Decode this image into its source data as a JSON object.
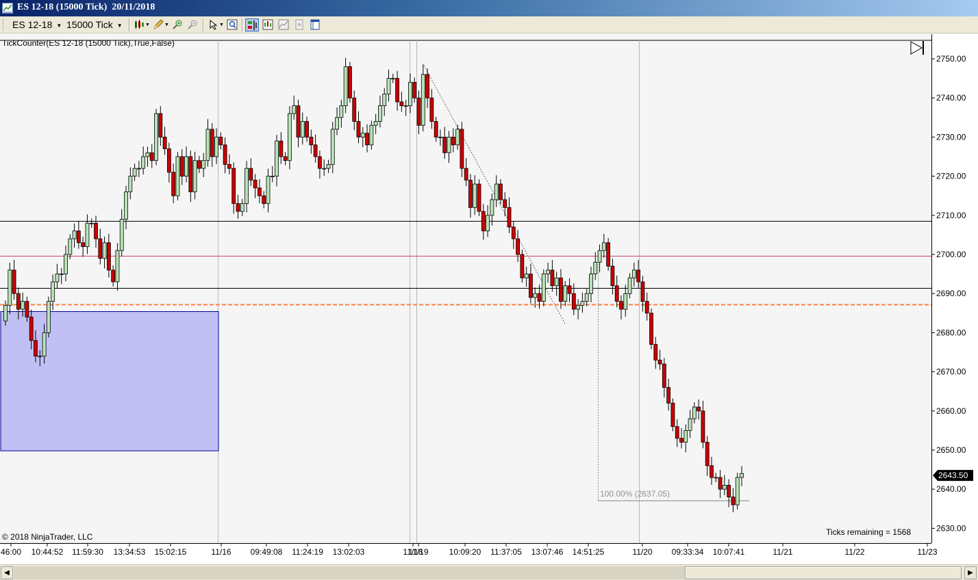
{
  "window": {
    "title": "ES 12-18 (15000 Tick)  20/11/2018"
  },
  "toolbar": {
    "instrument": "ES 12-18",
    "interval": "15000 Tick",
    "buttons": [
      {
        "name": "chart-style-button",
        "icon": "candlestick-icon"
      },
      {
        "name": "drawing-tools-button",
        "icon": "pencil-icon"
      },
      {
        "name": "zoom-in-button",
        "icon": "zoom-in-icon"
      },
      {
        "name": "zoom-out-button",
        "icon": "zoom-out-icon"
      },
      {
        "name": "cursor-button",
        "icon": "cursor-icon"
      },
      {
        "name": "magnifier-button",
        "icon": "magnifier-icon"
      },
      {
        "name": "order-panel-button",
        "icon": "chart-trader-icon"
      },
      {
        "name": "indicators-button",
        "icon": "indicators-icon"
      },
      {
        "name": "strategies-button",
        "icon": "strategy-icon"
      },
      {
        "name": "snapshot-button",
        "icon": "snapshot-icon"
      },
      {
        "name": "properties-button",
        "icon": "properties-icon"
      }
    ]
  },
  "chart": {
    "indicator_label": "TickCounter(ES  12-18 (15000 Tick),True,False)",
    "copyright": "© 2018 NinjaTrader, LLC",
    "ticks_remaining": "Ticks remaining = 1568",
    "fib_label": "100.00% (2637.05)",
    "last_price_label": "2643.50",
    "colors": {
      "up": "#b8e4b8",
      "down": "#cc0000",
      "background": "#f5f5f5",
      "box_fill": "#c0c0f4",
      "box_stroke": "#0000a0",
      "dashed_line": "#ff7f3f",
      "red_line": "#d04060"
    }
  },
  "chart_data": {
    "type": "candlestick",
    "y_axis": {
      "min": 2626,
      "max": 2752,
      "ticks": [
        "2750.00",
        "2740.00",
        "2730.00",
        "2720.00",
        "2710.00",
        "2700.00",
        "2690.00",
        "2680.00",
        "2670.00",
        "2660.00",
        "2650.00",
        "2640.00",
        "2630.00"
      ]
    },
    "x_axis": {
      "labels": [
        "46:00",
        "10:44:52",
        "11:59:30",
        "13:34:53",
        "15:02:15",
        "11/16",
        "09:49:08",
        "11:24:19",
        "13:02:03",
        "11/18",
        "11/19",
        "10:09:20",
        "11:37:05",
        "13:07:46",
        "14:51:25",
        "11/20",
        "09:33:34",
        "10:07:41",
        "11/21",
        "11/22",
        "11/23"
      ]
    },
    "horizontal_lines": [
      {
        "price": 2708.6,
        "color": "#000000",
        "style": "solid"
      },
      {
        "price": 2699.6,
        "color": "#d04060",
        "style": "solid"
      },
      {
        "price": 2691.4,
        "color": "#000000",
        "style": "solid"
      },
      {
        "price": 2687.3,
        "color": "#ff7f3f",
        "style": "dashed"
      }
    ],
    "rectangle": {
      "price_top": 2685.4,
      "price_bottom": 2649.8
    },
    "trend_line": {
      "from_price": 2748.3,
      "to_price": 2682.0
    },
    "fib_level": {
      "price": 2637.05,
      "label": "100.00% (2637.05)"
    },
    "last_price": 2643.5,
    "session_dividers": [
      "11/16",
      "11/18",
      "11/19",
      "11/20"
    ],
    "closes": [
      2687,
      2696,
      2690,
      2686,
      2688,
      2684,
      2678,
      2674,
      2674,
      2680,
      2688,
      2693,
      2695,
      2695,
      2700,
      2704,
      2706,
      2703,
      2702,
      2708,
      2708,
      2704,
      2699,
      2703,
      2696,
      2693,
      2701,
      2709,
      2716,
      2720,
      2722,
      2722,
      2725,
      2726,
      2724,
      2736,
      2730,
      2727,
      2721,
      2715,
      2725,
      2720,
      2725,
      2716,
      2724,
      2722,
      2724,
      2732,
      2725,
      2730,
      2728,
      2723,
      2722,
      2713,
      2711,
      2713,
      2722,
      2719,
      2717,
      2715,
      2713,
      2720,
      2720,
      2729,
      2725,
      2724,
      2736,
      2738,
      2730,
      2734,
      2730,
      2728,
      2725,
      2722,
      2722,
      2723,
      2732,
      2735,
      2738,
      2748,
      2740,
      2734,
      2730,
      2731,
      2728,
      2733,
      2734,
      2738,
      2741,
      2745,
      2745,
      2739,
      2738,
      2738,
      2744,
      2740,
      2733,
      2746,
      2740,
      2734,
      2730,
      2730,
      2726,
      2730,
      2728,
      2732,
      2722,
      2719,
      2712,
      2718,
      2711,
      2706,
      2710,
      2714,
      2718,
      2714,
      2712,
      2707,
      2704,
      2700,
      2694,
      2695,
      2689,
      2690,
      2688,
      2695,
      2696,
      2692,
      2694,
      2688,
      2692,
      2690,
      2686,
      2687,
      2688,
      2690,
      2695,
      2698,
      2701,
      2703,
      2697,
      2692,
      2688,
      2686,
      2690,
      2694,
      2696,
      2693,
      2688,
      2685,
      2677,
      2673,
      2672,
      2666,
      2662,
      2656,
      2653,
      2652,
      2655,
      2658,
      2661,
      2660,
      2652,
      2646,
      2643,
      2643,
      2640,
      2641,
      2638,
      2636,
      2643,
      2644
    ]
  }
}
